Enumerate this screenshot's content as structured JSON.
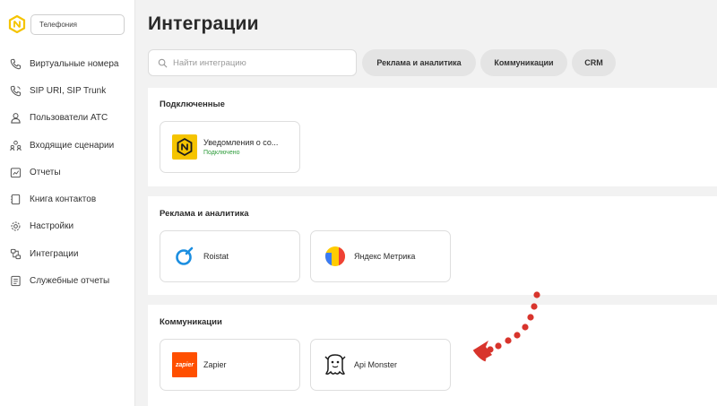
{
  "sidebar": {
    "product_select": "Телефония",
    "items": [
      {
        "label": "Виртуальные номера",
        "icon": "phone-icon"
      },
      {
        "label": "SIP URI, SIP Trunk",
        "icon": "sip-phone-icon"
      },
      {
        "label": "Пользователи АТС",
        "icon": "user-icon"
      },
      {
        "label": "Входящие сценарии",
        "icon": "users-scenario-icon"
      },
      {
        "label": "Отчеты",
        "icon": "report-icon"
      },
      {
        "label": "Книга контактов",
        "icon": "contacts-book-icon"
      },
      {
        "label": "Настройки",
        "icon": "gear-icon"
      },
      {
        "label": "Интеграции",
        "icon": "integrations-icon"
      },
      {
        "label": "Служебные отчеты",
        "icon": "service-report-icon"
      }
    ]
  },
  "header": {
    "title": "Интеграции"
  },
  "search": {
    "placeholder": "Найти интеграцию",
    "value": ""
  },
  "filters": [
    {
      "label": "Реклама и аналитика"
    },
    {
      "label": "Коммуникации"
    },
    {
      "label": "CRM"
    }
  ],
  "sections": {
    "connected": {
      "title": "Подключенные",
      "cards": [
        {
          "name": "Уведомления о со...",
          "status": "Подключено",
          "icon": "notifications-logo"
        }
      ]
    },
    "ads": {
      "title": "Реклама и аналитика",
      "cards": [
        {
          "name": "Roistat",
          "icon": "roistat-logo"
        },
        {
          "name": "Яндекс Метрика",
          "icon": "yandex-metrika-logo"
        }
      ]
    },
    "comm": {
      "title": "Коммуникации",
      "cards": [
        {
          "name": "Zapier",
          "icon": "zapier-logo",
          "logo_text": "zapier"
        },
        {
          "name": "Api Monster",
          "icon": "api-monster-logo"
        }
      ]
    }
  },
  "colors": {
    "brand_yellow": "#f5c400",
    "connected_green": "#2e9c3b",
    "zapier_orange": "#ff4f00",
    "annotation_red": "#d8342c"
  }
}
